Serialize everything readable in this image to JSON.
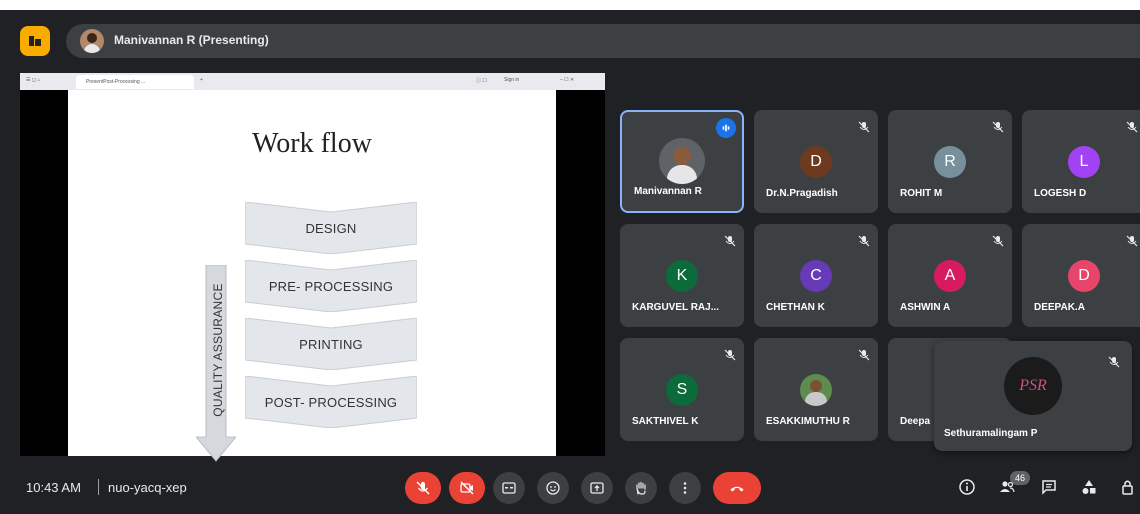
{
  "header": {
    "presenting_label": "Manivannan R (Presenting)"
  },
  "browser": {
    "tab_label": "PresentPost-Processing ...",
    "new_tab": "+",
    "sign_in": "Sign in"
  },
  "slide": {
    "title": "Work flow",
    "steps": [
      "DESIGN",
      "PRE- PROCESSING",
      "PRINTING",
      "POST- PROCESSING"
    ],
    "side_label": "QUALITY ASSURANCE"
  },
  "participants": [
    {
      "name": "Manivannan R",
      "initial": "",
      "color": "#5f6368",
      "speaking": true
    },
    {
      "name": "Dr.N.Pragadish",
      "initial": "D",
      "color": "#6d3a1f"
    },
    {
      "name": "ROHIT M",
      "initial": "R",
      "color": "#78909c"
    },
    {
      "name": "LOGESH D",
      "initial": "L",
      "color": "#a142f4"
    },
    {
      "name": "KARGUVEL RAJ...",
      "initial": "K",
      "color": "#0b6b3a"
    },
    {
      "name": "CHETHAN K",
      "initial": "C",
      "color": "#673ab7"
    },
    {
      "name": "ASHWIN A",
      "initial": "A",
      "color": "#d81b60"
    },
    {
      "name": "DEEPAK.A",
      "initial": "D",
      "color": "#e8456b"
    },
    {
      "name": "SAKTHIVEL K",
      "initial": "S",
      "color": "#0b6b3a"
    },
    {
      "name": "ESAKKIMUTHU R",
      "initial": "",
      "color": "#5e8b4e"
    },
    {
      "name": "Deepa",
      "initial": "",
      "color": "#5f6368"
    }
  ],
  "floating": {
    "name": "Sethuramalingam P",
    "avatar_text": "PSR"
  },
  "footer": {
    "time": "10:43 AM",
    "separator": "|",
    "meeting_code": "nuo-yacq-xep",
    "participant_count": "46"
  }
}
